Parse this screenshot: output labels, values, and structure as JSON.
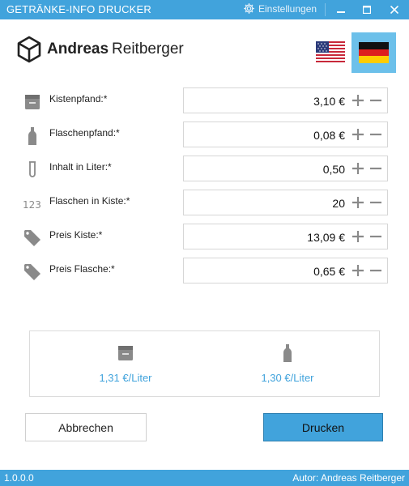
{
  "window": {
    "title": "GETRÄNKE-INFO DRUCKER",
    "settings_label": "Einstellungen",
    "settings_icon": "gear-icon",
    "controls": [
      "minimize-icon",
      "maximize-icon",
      "close-icon"
    ]
  },
  "brand": {
    "first": "Andreas",
    "last": "Reitberger",
    "logo_icon": "hexagon-cube-icon"
  },
  "languages": [
    {
      "name": "flag-us-icon",
      "selected": false
    },
    {
      "name": "flag-de-icon",
      "selected": true
    }
  ],
  "fields": [
    {
      "icon": "crate-icon",
      "label": "Kistenpfand:*",
      "value": "3,10 €"
    },
    {
      "icon": "bottle-icon",
      "label": "Flaschenpfand:*",
      "value": "0,08 €"
    },
    {
      "icon": "test-tube-icon",
      "label": "Inhalt in Liter:*",
      "value": "0,50"
    },
    {
      "icon": "numbers-icon",
      "label": "Flaschen in Kiste:*",
      "value": "20"
    },
    {
      "icon": "price-tag-icon",
      "label": "Preis Kiste:*",
      "value": "13,09 €"
    },
    {
      "icon": "price-tag-icon",
      "label": "Preis Flasche:*",
      "value": "0,65 €"
    }
  ],
  "summary": {
    "crate": {
      "icon": "crate-icon",
      "value": "1,31 €/Liter"
    },
    "bottle": {
      "icon": "bottle-icon",
      "value": "1,30 €/Liter"
    }
  },
  "buttons": {
    "cancel": "Abbrechen",
    "print": "Drucken"
  },
  "status": {
    "version": "1.0.0.0",
    "author": "Autor: Andreas Reitberger"
  },
  "colors": {
    "accent": "#41a3dc",
    "icon_gray": "#8a8a8a",
    "selected_flag_bg": "#6cc0ea"
  }
}
